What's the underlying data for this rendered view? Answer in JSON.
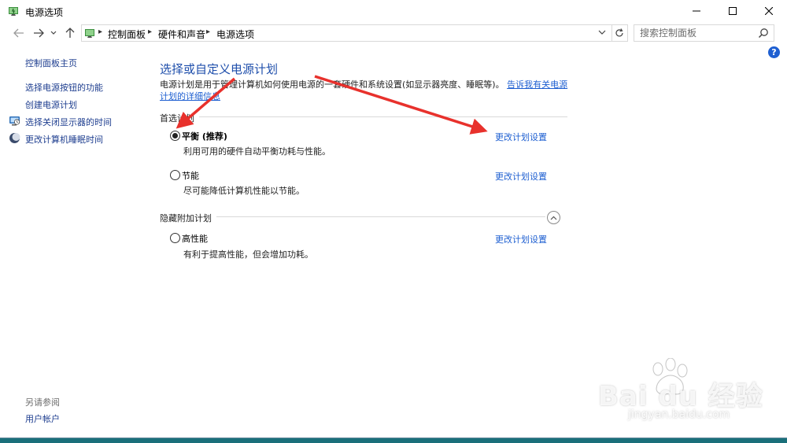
{
  "window": {
    "title": "电源选项",
    "accent": "#1e5fd1"
  },
  "address_bar": {
    "breadcrumbs": [
      "控制面板",
      "硬件和声音",
      "电源选项"
    ]
  },
  "search": {
    "placeholder": "搜索控制面板"
  },
  "help": {
    "label": "?"
  },
  "sidebar": {
    "home": "控制面板主页",
    "items": [
      {
        "label": "选择电源按钮的功能",
        "icon": ""
      },
      {
        "label": "创建电源计划",
        "icon": ""
      },
      {
        "label": "选择关闭显示器的时间",
        "icon": "monitor-icon"
      },
      {
        "label": "更改计算机睡眠时间",
        "icon": "moon-icon"
      }
    ],
    "see_also_label": "另请参阅",
    "see_also_items": [
      "用户帐户"
    ]
  },
  "main": {
    "title": "选择或自定义电源计划",
    "description": "电源计划是用于管理计算机如何使用电源的一套硬件和系统设置(如显示器亮度、睡眠等)。",
    "description_link": "告诉我有关电源计划的详细信息",
    "preferred_section": "首选计划",
    "hidden_section": "隐藏附加计划",
    "plans": [
      {
        "name": "平衡 (推荐)",
        "description": "利用可用的硬件自动平衡功耗与性能。",
        "selected": true,
        "link": "更改计划设置"
      },
      {
        "name": "节能",
        "description": "尽可能降低计算机性能以节能。",
        "selected": false,
        "link": "更改计划设置"
      },
      {
        "name": "高性能",
        "description": "有利于提高性能，但会增加功耗。",
        "selected": false,
        "link": "更改计划设置"
      }
    ]
  },
  "watermark": {
    "logo": "Bai  du 经验",
    "url": "jingyan.baidu.com"
  },
  "annotation_color": "#e8312c"
}
